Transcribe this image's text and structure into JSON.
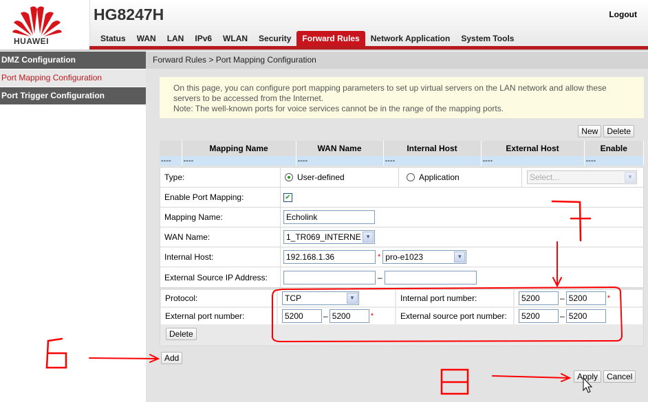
{
  "header": {
    "brand": "HUAWEI",
    "model": "HG8247H",
    "logout_label": "Logout",
    "nav": [
      {
        "label": "Status"
      },
      {
        "label": "WAN"
      },
      {
        "label": "LAN"
      },
      {
        "label": "IPv6"
      },
      {
        "label": "WLAN"
      },
      {
        "label": "Security"
      },
      {
        "label": "Forward Rules",
        "active": true
      },
      {
        "label": "Network Application"
      },
      {
        "label": "System Tools"
      }
    ]
  },
  "sidebar": {
    "items": [
      {
        "label": "DMZ Configuration"
      },
      {
        "label": "Port Mapping Configuration",
        "active": true
      },
      {
        "label": "Port Trigger Configuration"
      }
    ]
  },
  "breadcrumb": "Forward Rules > Port Mapping Configuration",
  "notice": {
    "line1": "On this page, you can configure port mapping parameters to set up virtual servers on the LAN network and allow these servers to be accessed from the Internet.",
    "line2": "Note: The well-known ports for voice services cannot be in the range of the mapping ports."
  },
  "table": {
    "new_label": "New",
    "delete_label": "Delete",
    "columns": [
      "",
      "Mapping Name",
      "WAN Name",
      "Internal Host",
      "External Host",
      "Enable"
    ],
    "row": [
      "----",
      "----",
      "----",
      "----",
      "----",
      "----"
    ]
  },
  "form": {
    "type_label": "Type:",
    "type_options": [
      "User-defined",
      "Application"
    ],
    "type_selected": "User-defined",
    "app_select_placeholder": "Select...",
    "enable_label": "Enable Port Mapping:",
    "enable_checked": true,
    "mapping_name_label": "Mapping Name:",
    "mapping_name_value": "Echolink",
    "wan_name_label": "WAN Name:",
    "wan_name_value": "1_TR069_INTERNE",
    "internal_host_label": "Internal Host:",
    "internal_host_value": "192.168.1.36",
    "internal_host_device": "pro-e1023",
    "external_source_ip_label": "External Source IP Address:",
    "external_source_ip_start": "",
    "external_source_ip_end": ""
  },
  "ports": {
    "protocol_label": "Protocol:",
    "protocol_value": "TCP",
    "internal_port_label": "Internal port number:",
    "internal_port_start": "5200",
    "internal_port_end": "5200",
    "external_port_label": "External port number:",
    "external_port_start": "5200",
    "external_port_end": "5200",
    "external_source_port_label": "External source port number:",
    "external_source_port_start": "5200",
    "external_source_port_end": "5200",
    "delete_label": "Delete"
  },
  "actions": {
    "add_label": "Add",
    "apply_label": "Apply",
    "cancel_label": "Cancel"
  },
  "annotations": {
    "six": "6",
    "seven": "7",
    "eight": "8",
    "color": "#ff0000"
  },
  "colors": {
    "brand_red": "#c8151d",
    "sidebar_dark": "#5b5b5b",
    "notice_bg": "#fdfbe2"
  }
}
